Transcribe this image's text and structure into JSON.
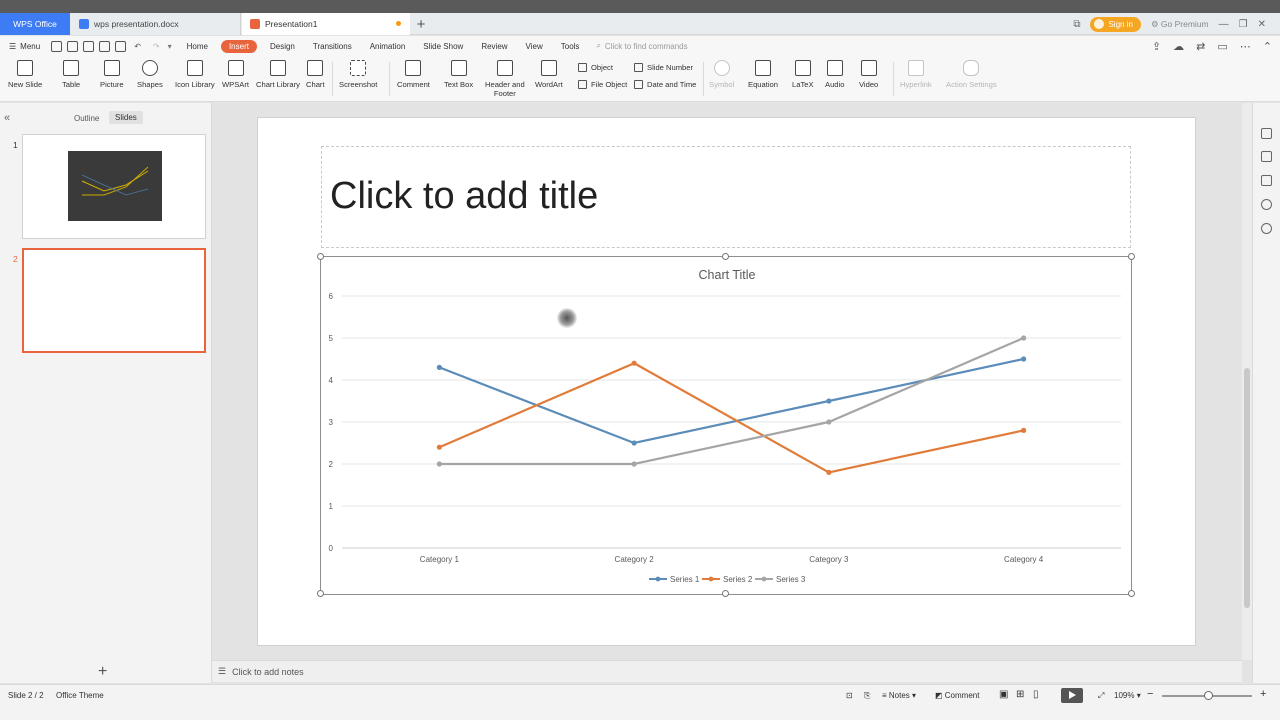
{
  "tabs": {
    "wps": "WPS Office",
    "doc": "wps presentation.docx",
    "ppt": "Presentation1"
  },
  "window": {
    "signin": "Sign in",
    "premium": "Go Premium"
  },
  "menu": {
    "menu_label": "Menu",
    "items": [
      "Home",
      "Insert",
      "Design",
      "Transitions",
      "Animation",
      "Slide Show",
      "Review",
      "View",
      "Tools"
    ],
    "find_placeholder": "Click to find commands"
  },
  "ribbon": {
    "new_slide": "New Slide",
    "table": "Table",
    "picture": "Picture",
    "shapes": "Shapes",
    "icon_library": "Icon Library",
    "wpsart": "WPSArt",
    "chart_library": "Chart Library",
    "chart": "Chart",
    "screenshot": "Screenshot",
    "comment": "Comment",
    "text_box": "Text Box",
    "header_footer_1": "Header and",
    "header_footer_2": "Footer",
    "wordart": "WordArt",
    "object": "Object",
    "file_object": "File Object",
    "slide_number": "Slide Number",
    "date_time": "Date and Time",
    "symbol": "Symbol",
    "equation": "Equation",
    "latex": "LaTeX",
    "audio": "Audio",
    "video": "Video",
    "hyperlink": "Hyperlink",
    "action_settings": "Action Settings"
  },
  "leftpane": {
    "outline": "Outline",
    "slides": "Slides",
    "slide_numbers": [
      "1",
      "2"
    ]
  },
  "slide": {
    "title_placeholder": "Click to add title"
  },
  "chart_data": {
    "type": "line",
    "title": "Chart Title",
    "categories": [
      "Category 1",
      "Category 2",
      "Category 3",
      "Category 4"
    ],
    "ylim": [
      0,
      6
    ],
    "yticks": [
      0,
      1,
      2,
      3,
      4,
      5,
      6
    ],
    "grid": true,
    "legend": "bottom",
    "series": [
      {
        "name": "Series 1",
        "color": "#5b8db8",
        "values": [
          4.3,
          2.5,
          3.5,
          4.5
        ]
      },
      {
        "name": "Series 2",
        "color": "#e07b39",
        "values": [
          2.4,
          4.4,
          1.8,
          2.8
        ]
      },
      {
        "name": "Series 3",
        "color": "#a5a5a5",
        "values": [
          2,
          2,
          3,
          5
        ]
      }
    ]
  },
  "notes": {
    "placeholder": "Click to add notes"
  },
  "status": {
    "slide_count": "Slide 2 / 2",
    "theme": "Office Theme",
    "notes": "Notes",
    "comment": "Comment",
    "zoom": "109%"
  }
}
